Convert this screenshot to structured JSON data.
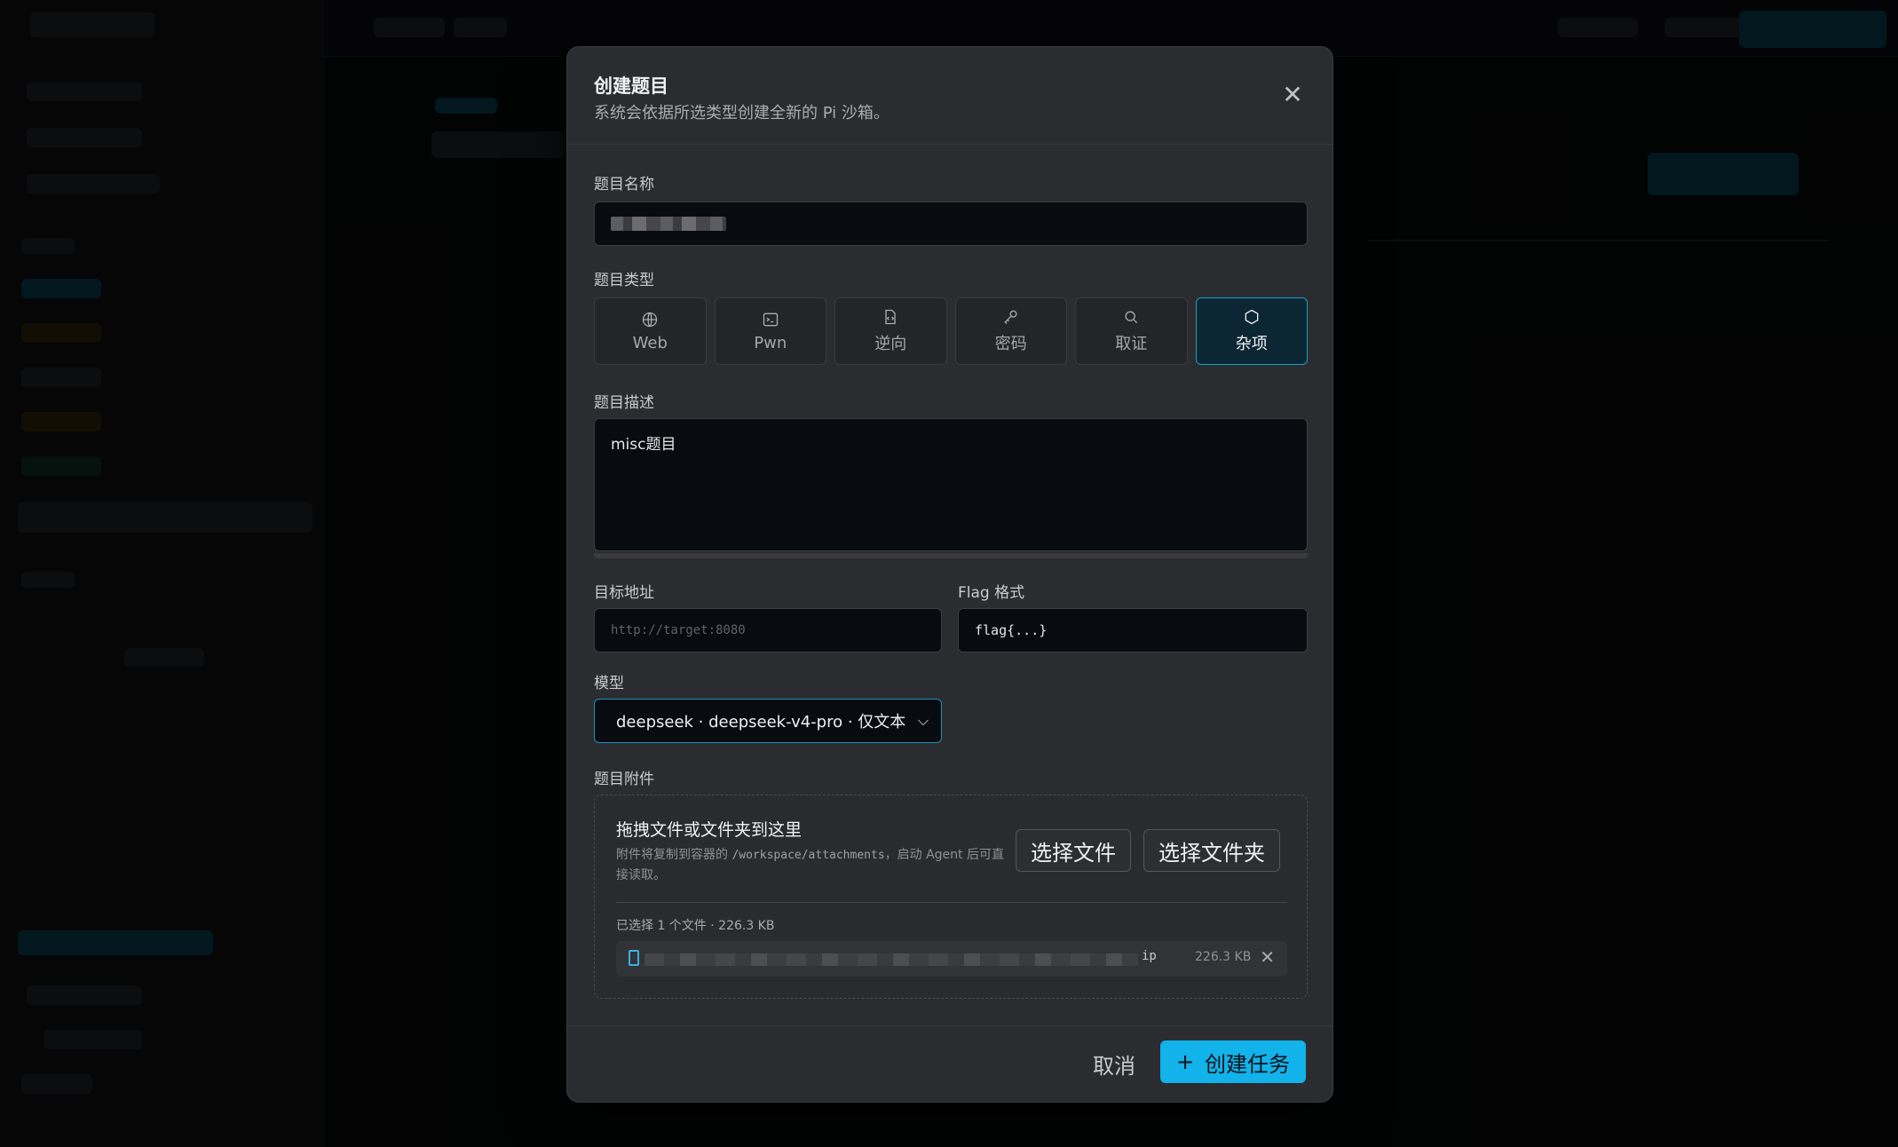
{
  "modal": {
    "title": "创建题目",
    "subtitle": "系统会依据所选类型创建全新的 Pi 沙箱。",
    "close_glyph": "✕"
  },
  "form": {
    "name_label": "题目名称",
    "type_label": "题目类型",
    "types": [
      {
        "label": "Web",
        "icon": "globe-icon",
        "selected": false
      },
      {
        "label": "Pwn",
        "icon": "terminal-icon",
        "selected": false
      },
      {
        "label": "逆向",
        "icon": "file-code-icon",
        "selected": false
      },
      {
        "label": "密码",
        "icon": "key-icon",
        "selected": false
      },
      {
        "label": "取证",
        "icon": "search-icon",
        "selected": false
      },
      {
        "label": "杂项",
        "icon": "hexagon-icon",
        "selected": true
      }
    ],
    "description_label": "题目描述",
    "description_value": "misc题目",
    "target_label": "目标地址",
    "target_placeholder": "http://target:8080",
    "flag_label": "Flag 格式",
    "flag_value": "flag{...}",
    "model_label": "模型",
    "model_value": "deepseek · deepseek-v4-pro · 仅文本",
    "attachments_label": "题目附件"
  },
  "attachments": {
    "drop_title": "拖拽文件或文件夹到这里",
    "hint_prefix": "附件将复制到容器的 ",
    "hint_path": "/workspace/attachments",
    "hint_suffix": "，启动 Agent 后可直接读取。",
    "choose_file_label": "选择文件",
    "choose_folder_label": "选择文件夹",
    "selected_summary": "已选择 1 个文件 · 226.3 KB",
    "files": [
      {
        "name_suffix": "ip",
        "size": "226.3 KB"
      }
    ],
    "remove_glyph": "✕"
  },
  "footer": {
    "cancel_label": "取消",
    "create_icon": "+",
    "create_label": "创建任务"
  },
  "colors": {
    "accent": "#12b2ea",
    "selected_border": "#14a3c8",
    "modal_bg": "#2b2c2f"
  }
}
